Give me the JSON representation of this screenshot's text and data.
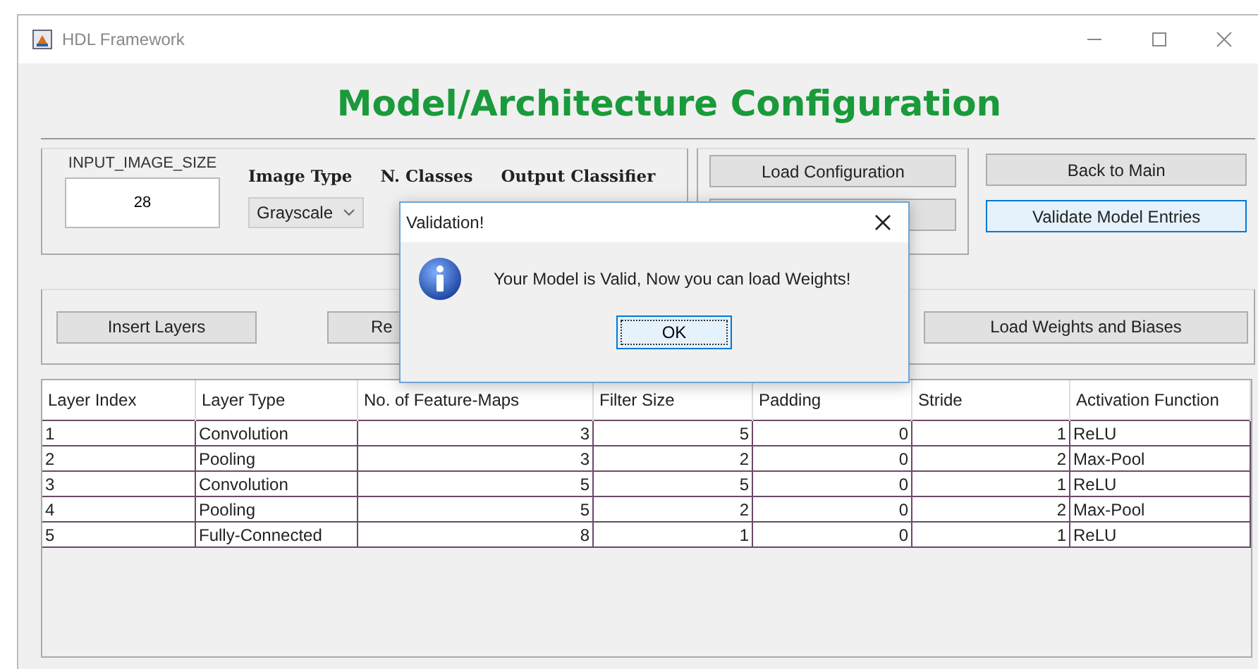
{
  "window": {
    "title": "HDL Framework"
  },
  "heading": "Model/Architecture Configuration",
  "input_image_size": {
    "label": "INPUT_IMAGE_SIZE",
    "value": "28"
  },
  "image_type": {
    "label": "Image Type",
    "value": "Grayscale"
  },
  "labels": [
    "N. Classes",
    "Output Classifier"
  ],
  "config_button": "Load Configuration",
  "nav_buttons": [
    {
      "label": "Back to Main",
      "focused": false
    },
    {
      "label": "Validate Model Entries",
      "focused": true
    }
  ],
  "layer_buttons": [
    "Insert Layers",
    "Re",
    "Load Weights and Biases"
  ],
  "table": {
    "columns": [
      "Layer Index",
      "Layer Type",
      "No. of Feature-Maps",
      "Filter Size",
      "Padding",
      "Stride",
      "Activation Function"
    ],
    "rows": [
      [
        "1",
        "Convolution",
        "3",
        "5",
        "0",
        "1",
        "ReLU"
      ],
      [
        "2",
        "Pooling",
        "3",
        "2",
        "0",
        "2",
        "Max-Pool"
      ],
      [
        "3",
        "Convolution",
        "5",
        "5",
        "0",
        "1",
        "ReLU"
      ],
      [
        "4",
        "Pooling",
        "5",
        "2",
        "0",
        "2",
        "Max-Pool"
      ],
      [
        "5",
        "Fully-Connected",
        "8",
        "1",
        "0",
        "1",
        "ReLU"
      ]
    ]
  },
  "dialog": {
    "title": "Validation!",
    "message": "Your Model is Valid, Now you can load Weights!",
    "button": "OK"
  }
}
